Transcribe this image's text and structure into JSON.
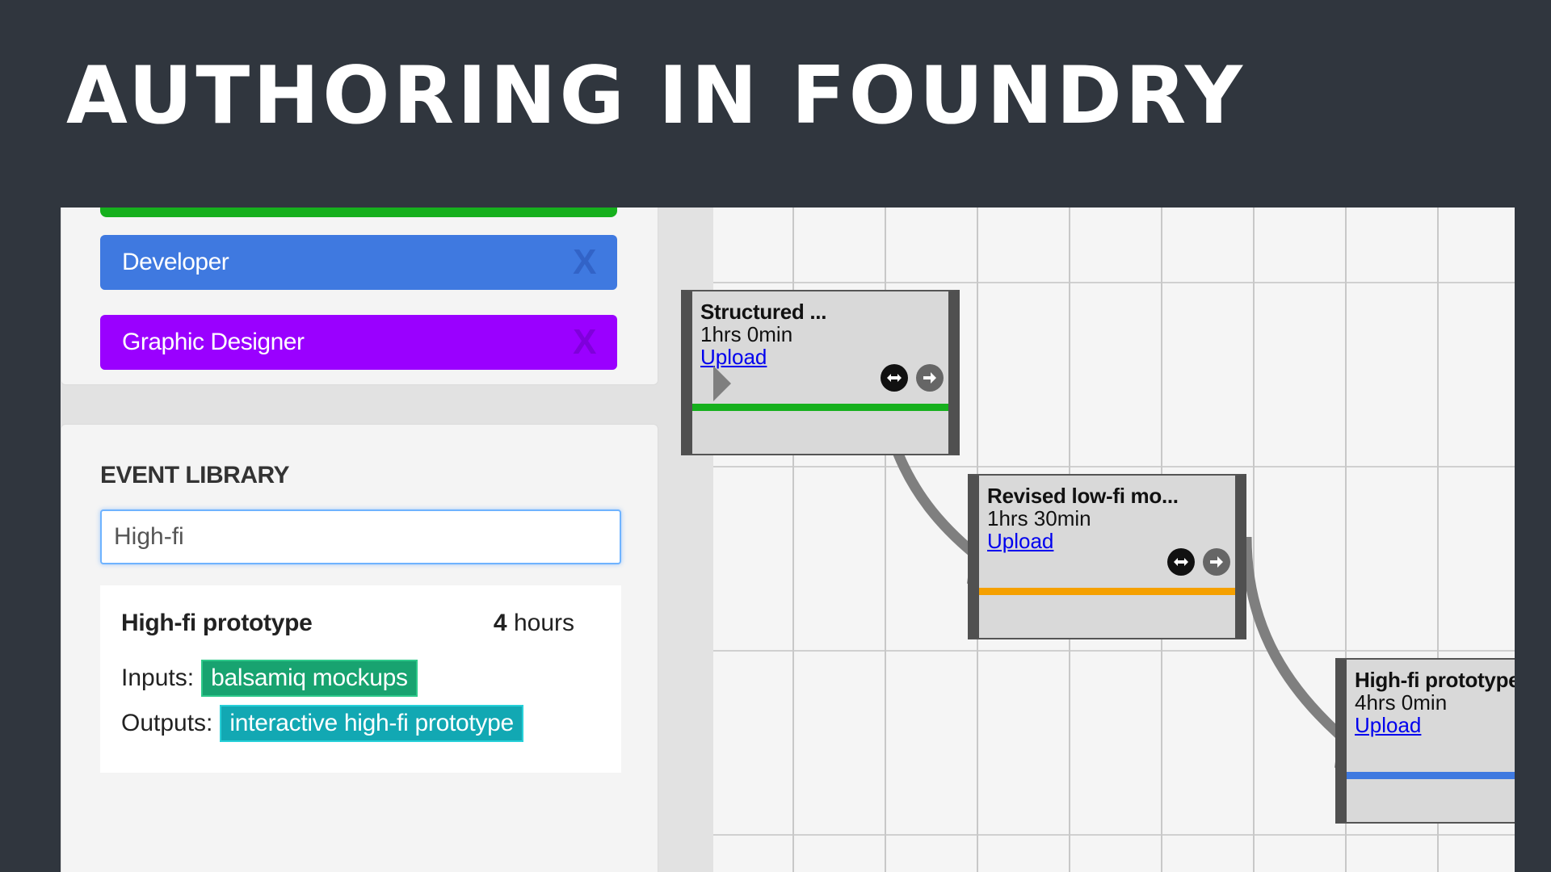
{
  "slide_title": "AUTHORING IN FOUNDRY",
  "roles": [
    {
      "label": "Developer",
      "remove": "X",
      "color": "#3f79e0"
    },
    {
      "label": "Graphic Designer",
      "remove": "X",
      "color": "#9a00ff"
    }
  ],
  "library": {
    "heading": "EVENT LIBRARY",
    "search_value": "High-fi",
    "result": {
      "name": "High-fi prototype",
      "duration_value": "4",
      "duration_unit": "hours",
      "inputs_label": "Inputs:",
      "input_tag": "balsamiq mockups",
      "outputs_label": "Outputs:",
      "output_tag": "interactive high-fi prototype"
    }
  },
  "timeline": {
    "tasks": [
      {
        "title": "Structured ...",
        "duration": "1hrs 0min",
        "upload": "Upload",
        "bar_color": "#16b01d"
      },
      {
        "title": "Revised low-fi mo...",
        "duration": "1hrs 30min",
        "upload": "Upload",
        "bar_color": "#f5a000"
      },
      {
        "title": "High-fi prototype",
        "duration": "4hrs 0min",
        "upload": "Upload",
        "bar_color": "#3f79e0"
      }
    ]
  },
  "icons": {
    "swap": "swap-arrows-icon",
    "next": "arrow-right-icon",
    "remove": "close-icon"
  }
}
